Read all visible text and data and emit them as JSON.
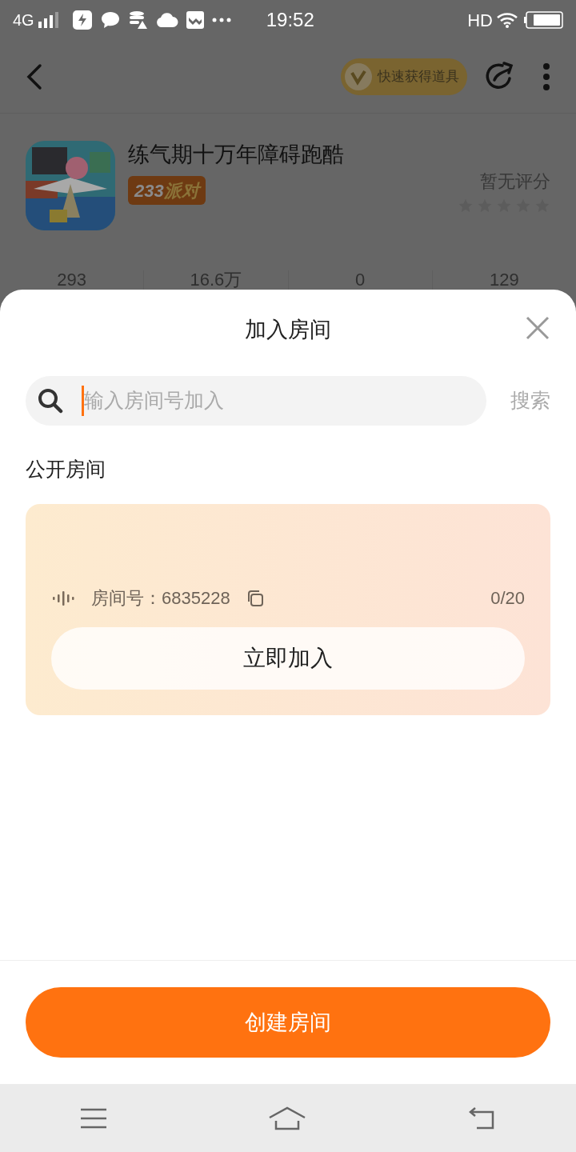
{
  "status_bar": {
    "network": "4G",
    "time": "19:52",
    "hd": "HD"
  },
  "header": {
    "promo": "快速获得道具"
  },
  "game": {
    "title": "练气期十万年障碍跑酷",
    "tag_number": "233",
    "tag_text": "派对",
    "rating_text": "暂无评分"
  },
  "stats": [
    "293",
    "16.6万",
    "0",
    "129"
  ],
  "sheet": {
    "title": "加入房间",
    "search": {
      "placeholder": "输入房间号加入",
      "button": "搜索"
    },
    "section_title": "公开房间",
    "rooms": [
      {
        "label": "房间号：",
        "number": "6835228",
        "occupancy": "0/20",
        "join": "立即加入"
      }
    ],
    "create": "创建房间"
  }
}
